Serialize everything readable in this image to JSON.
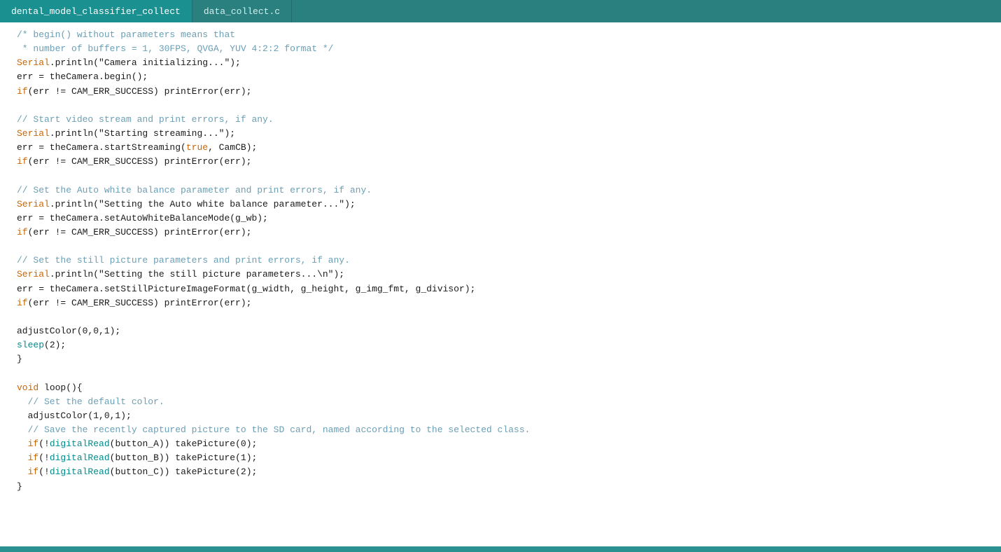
{
  "tabs": [
    {
      "id": "tab1",
      "label": "dental_model_classifier_collect",
      "active": true
    },
    {
      "id": "tab2",
      "label": "data_collect.c",
      "active": false
    }
  ],
  "code_lines": [
    {
      "id": 1,
      "tokens": [
        {
          "t": "comment",
          "v": "/* begin() without parameters means that"
        }
      ]
    },
    {
      "id": 2,
      "tokens": [
        {
          "t": "comment",
          "v": " * number of buffers = 1, 30FPS, QVGA, YUV 4:2:2 format */"
        }
      ]
    },
    {
      "id": 3,
      "tokens": [
        {
          "t": "serial",
          "v": "Serial"
        },
        {
          "t": "normal",
          "v": ".println(\"Camera initializing...\");"
        }
      ]
    },
    {
      "id": 4,
      "tokens": [
        {
          "t": "normal",
          "v": "err = theCamera.begin();"
        }
      ]
    },
    {
      "id": 5,
      "tokens": [
        {
          "t": "keyword",
          "v": "if"
        },
        {
          "t": "normal",
          "v": "(err != CAM_ERR_SUCCESS) printError(err);"
        }
      ]
    },
    {
      "id": 6,
      "tokens": [
        {
          "t": "normal",
          "v": ""
        }
      ]
    },
    {
      "id": 7,
      "tokens": [
        {
          "t": "comment",
          "v": "// Start video stream and print errors, if any."
        }
      ]
    },
    {
      "id": 8,
      "tokens": [
        {
          "t": "serial",
          "v": "Serial"
        },
        {
          "t": "normal",
          "v": ".println(\"Starting streaming...\");"
        }
      ]
    },
    {
      "id": 9,
      "tokens": [
        {
          "t": "normal",
          "v": "err = theCamera.startStreaming("
        },
        {
          "t": "keyword",
          "v": "true"
        },
        {
          "t": "normal",
          "v": ", CamCB);"
        }
      ]
    },
    {
      "id": 10,
      "tokens": [
        {
          "t": "keyword",
          "v": "if"
        },
        {
          "t": "normal",
          "v": "(err != CAM_ERR_SUCCESS) printError(err);"
        }
      ]
    },
    {
      "id": 11,
      "tokens": [
        {
          "t": "normal",
          "v": ""
        }
      ]
    },
    {
      "id": 12,
      "tokens": [
        {
          "t": "comment",
          "v": "// Set the Auto white balance parameter and print errors, if any."
        }
      ]
    },
    {
      "id": 13,
      "tokens": [
        {
          "t": "serial",
          "v": "Serial"
        },
        {
          "t": "normal",
          "v": ".println(\"Setting the Auto white balance parameter...\");"
        }
      ]
    },
    {
      "id": 14,
      "tokens": [
        {
          "t": "normal",
          "v": "err = theCamera.setAutoWhiteBalanceMode(g_wb);"
        }
      ]
    },
    {
      "id": 15,
      "tokens": [
        {
          "t": "keyword",
          "v": "if"
        },
        {
          "t": "normal",
          "v": "(err != CAM_ERR_SUCCESS) printError(err);"
        }
      ]
    },
    {
      "id": 16,
      "tokens": [
        {
          "t": "normal",
          "v": ""
        }
      ]
    },
    {
      "id": 17,
      "tokens": [
        {
          "t": "comment",
          "v": "// Set the still picture parameters and print errors, if any."
        }
      ]
    },
    {
      "id": 18,
      "tokens": [
        {
          "t": "serial",
          "v": "Serial"
        },
        {
          "t": "normal",
          "v": ".println(\"Setting the still picture parameters...\\n\");"
        }
      ]
    },
    {
      "id": 19,
      "tokens": [
        {
          "t": "normal",
          "v": "err = theCamera.setStillPictureImageFormat(g_width, g_height, g_img_fmt, g_divisor);"
        }
      ]
    },
    {
      "id": 20,
      "tokens": [
        {
          "t": "keyword",
          "v": "if"
        },
        {
          "t": "normal",
          "v": "(err != CAM_ERR_SUCCESS) printError(err);"
        }
      ]
    },
    {
      "id": 21,
      "tokens": [
        {
          "t": "normal",
          "v": ""
        }
      ]
    },
    {
      "id": 22,
      "tokens": [
        {
          "t": "normal",
          "v": "adjustColor(0,0,1);"
        }
      ]
    },
    {
      "id": 23,
      "tokens": [
        {
          "t": "teal",
          "v": "sleep"
        },
        {
          "t": "normal",
          "v": "(2);"
        }
      ]
    },
    {
      "id": 24,
      "tokens": [
        {
          "t": "normal",
          "v": "}"
        }
      ]
    },
    {
      "id": 25,
      "tokens": [
        {
          "t": "normal",
          "v": ""
        }
      ]
    },
    {
      "id": 26,
      "tokens": [
        {
          "t": "keyword",
          "v": "void"
        },
        {
          "t": "normal",
          "v": " loop(){"
        }
      ]
    },
    {
      "id": 27,
      "tokens": [
        {
          "t": "comment",
          "v": "  // Set the default color."
        }
      ]
    },
    {
      "id": 28,
      "tokens": [
        {
          "t": "normal",
          "v": "  adjustColor(1,0,1);"
        }
      ]
    },
    {
      "id": 29,
      "tokens": [
        {
          "t": "comment",
          "v": "  // Save the recently captured picture to the SD card, named according to the selected class."
        }
      ]
    },
    {
      "id": 30,
      "tokens": [
        {
          "t": "normal",
          "v": "  "
        },
        {
          "t": "keyword",
          "v": "if"
        },
        {
          "t": "normal",
          "v": "(!"
        },
        {
          "t": "teal",
          "v": "digitalRead"
        },
        {
          "t": "normal",
          "v": "(button_A)) takePicture(0);"
        }
      ]
    },
    {
      "id": 31,
      "tokens": [
        {
          "t": "normal",
          "v": "  "
        },
        {
          "t": "keyword",
          "v": "if"
        },
        {
          "t": "normal",
          "v": "(!"
        },
        {
          "t": "teal",
          "v": "digitalRead"
        },
        {
          "t": "normal",
          "v": "(button_B)) takePicture(1);"
        }
      ]
    },
    {
      "id": 32,
      "tokens": [
        {
          "t": "normal",
          "v": "  "
        },
        {
          "t": "keyword",
          "v": "if"
        },
        {
          "t": "normal",
          "v": "(!"
        },
        {
          "t": "teal",
          "v": "digitalRead"
        },
        {
          "t": "normal",
          "v": "(button_C)) takePicture(2);"
        }
      ]
    },
    {
      "id": 33,
      "tokens": [
        {
          "t": "normal",
          "v": "}"
        }
      ]
    }
  ]
}
